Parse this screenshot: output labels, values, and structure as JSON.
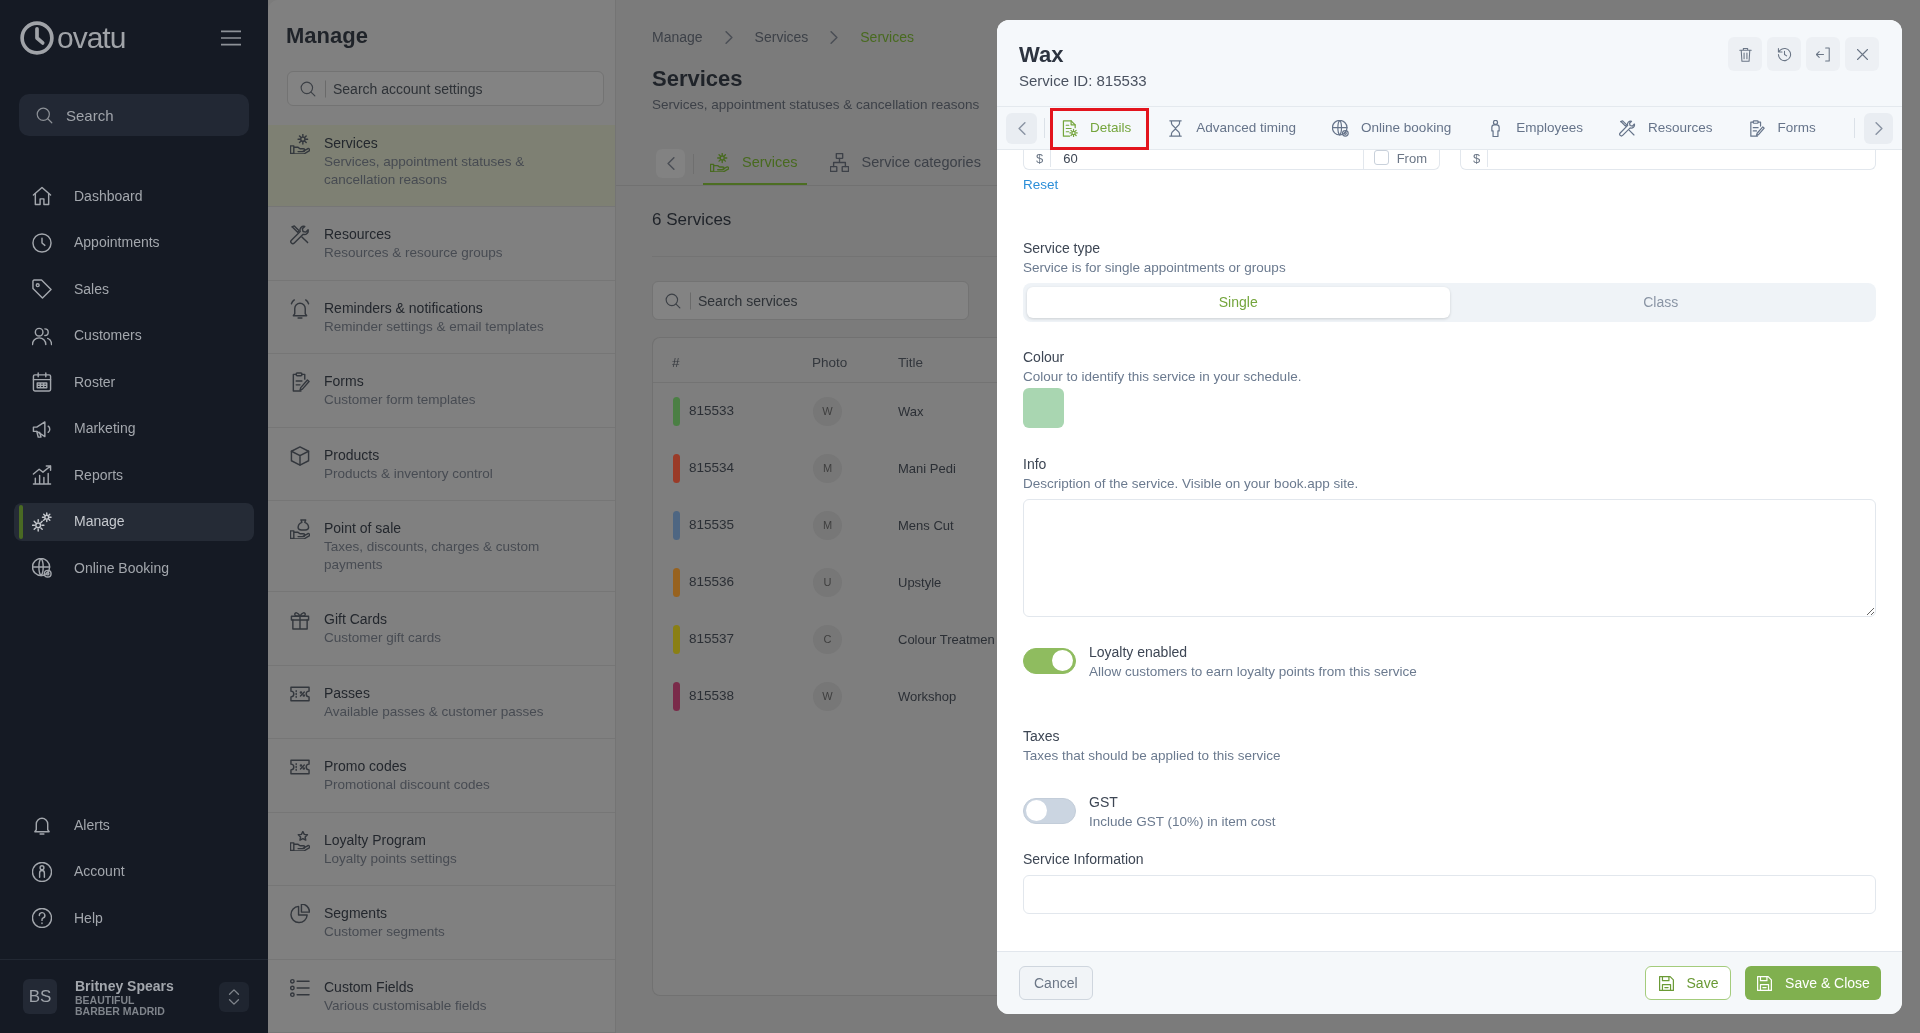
{
  "sidebar": {
    "logo": "ovatu",
    "search": {
      "placeholder": "Search"
    },
    "nav": [
      {
        "label": "Dashboard",
        "selected": false
      },
      {
        "label": "Appointments",
        "selected": false
      },
      {
        "label": "Sales",
        "selected": false
      },
      {
        "label": "Customers",
        "selected": false
      },
      {
        "label": "Roster",
        "selected": false
      },
      {
        "label": "Marketing",
        "selected": false
      },
      {
        "label": "Reports",
        "selected": false
      },
      {
        "label": "Manage",
        "selected": true
      },
      {
        "label": "Online Booking",
        "selected": false
      }
    ],
    "bottom_nav": [
      {
        "label": "Alerts",
        "selected": false
      },
      {
        "label": "Account",
        "selected": false
      },
      {
        "label": "Help",
        "selected": false
      }
    ],
    "user": {
      "initials": "BS",
      "name": "Britney Spears",
      "business": "BEAUTIFUL BARBER MADRID"
    }
  },
  "settings": {
    "title": "Manage",
    "search": {
      "placeholder": "Search account settings"
    },
    "items": [
      {
        "title": "Services",
        "subtitle": "Services, appointment statuses & cancellation reasons",
        "selected": true
      },
      {
        "title": "Resources",
        "subtitle": "Resources & resource groups",
        "selected": false
      },
      {
        "title": "Reminders & notifications",
        "subtitle": "Reminder settings & email templates",
        "selected": false
      },
      {
        "title": "Forms",
        "subtitle": "Customer form templates",
        "selected": false
      },
      {
        "title": "Products",
        "subtitle": "Products & inventory control",
        "selected": false
      },
      {
        "title": "Point of sale",
        "subtitle": "Taxes, discounts, charges & custom payments",
        "selected": false
      },
      {
        "title": "Gift Cards",
        "subtitle": "Customer gift cards",
        "selected": false
      },
      {
        "title": "Passes",
        "subtitle": "Available passes & customer passes",
        "selected": false
      },
      {
        "title": "Promo codes",
        "subtitle": "Promotional discount codes",
        "selected": false
      },
      {
        "title": "Loyalty Program",
        "subtitle": "Loyalty points settings",
        "selected": false
      },
      {
        "title": "Segments",
        "subtitle": "Customer segments",
        "selected": false
      },
      {
        "title": "Custom Fields",
        "subtitle": "Various customisable fields",
        "selected": false
      }
    ]
  },
  "services_page": {
    "breadcrumbs": [
      {
        "label": "Manage",
        "current": false
      },
      {
        "label": "Services",
        "current": false
      },
      {
        "label": "Services",
        "current": true
      }
    ],
    "title": "Services",
    "subtitle": "Services, appointment statuses & cancellation reasons",
    "tabs": [
      {
        "label": "Services",
        "selected": true
      },
      {
        "label": "Service categories",
        "selected": false
      }
    ],
    "count": "6 Services",
    "search": {
      "placeholder": "Search services"
    },
    "table": {
      "columns": [
        "#",
        "Photo",
        "Title"
      ],
      "rows": [
        {
          "id": "815533",
          "color": "#4b7f44",
          "photo": "W",
          "title": "Wax"
        },
        {
          "id": "815534",
          "color": "#9a3b28",
          "photo": "M",
          "title": "Mani Pedi"
        },
        {
          "id": "815535",
          "color": "#4e6682",
          "photo": "M",
          "title": "Mens Cut"
        },
        {
          "id": "815536",
          "color": "#97621f",
          "photo": "U",
          "title": "Upstyle"
        },
        {
          "id": "815537",
          "color": "#8a7f14",
          "photo": "C",
          "title": "Colour Treatmen"
        },
        {
          "id": "815538",
          "color": "#7a2b4a",
          "photo": "W",
          "title": "Workshop"
        }
      ]
    }
  },
  "dialog": {
    "title": "Wax",
    "subtitle": "Service ID: 815533",
    "tabs": [
      {
        "label": "Details",
        "selected": true,
        "marked": true
      },
      {
        "label": "Advanced timing",
        "selected": false,
        "marked": false
      },
      {
        "label": "Online booking",
        "selected": false,
        "marked": false
      },
      {
        "label": "Employees",
        "selected": false,
        "marked": false
      },
      {
        "label": "Resources",
        "selected": false,
        "marked": false
      },
      {
        "label": "Forms",
        "selected": false,
        "marked": false
      }
    ],
    "price_row": {
      "prefix": "$",
      "value": "60",
      "from": {
        "label": "From",
        "checked": false
      },
      "second_prefix": "$"
    },
    "reset": "Reset",
    "service_type": {
      "label": "Service type",
      "hint": "Service is for single appointments or groups",
      "options": [
        {
          "label": "Single",
          "selected": true
        },
        {
          "label": "Class",
          "selected": false
        }
      ]
    },
    "colour": {
      "label": "Colour",
      "hint": "Colour to identify this service in your schedule.",
      "color": "#a9d6b1"
    },
    "info": {
      "label": "Info",
      "hint": "Description of the service. Visible on your book.app site."
    },
    "loyalty": {
      "label": "Loyalty enabled",
      "hint": "Allow customers to earn loyalty points from this service",
      "on": true
    },
    "taxes": {
      "label": "Taxes",
      "hint": "Taxes that should be applied to this service",
      "items": [
        {
          "label": "GST",
          "hint": "Include GST (10%) in item cost",
          "on": false
        }
      ]
    },
    "service_information": {
      "label": "Service Information"
    },
    "footer": {
      "cancel": "Cancel",
      "save": "Save",
      "save_close": "Save & Close"
    }
  }
}
